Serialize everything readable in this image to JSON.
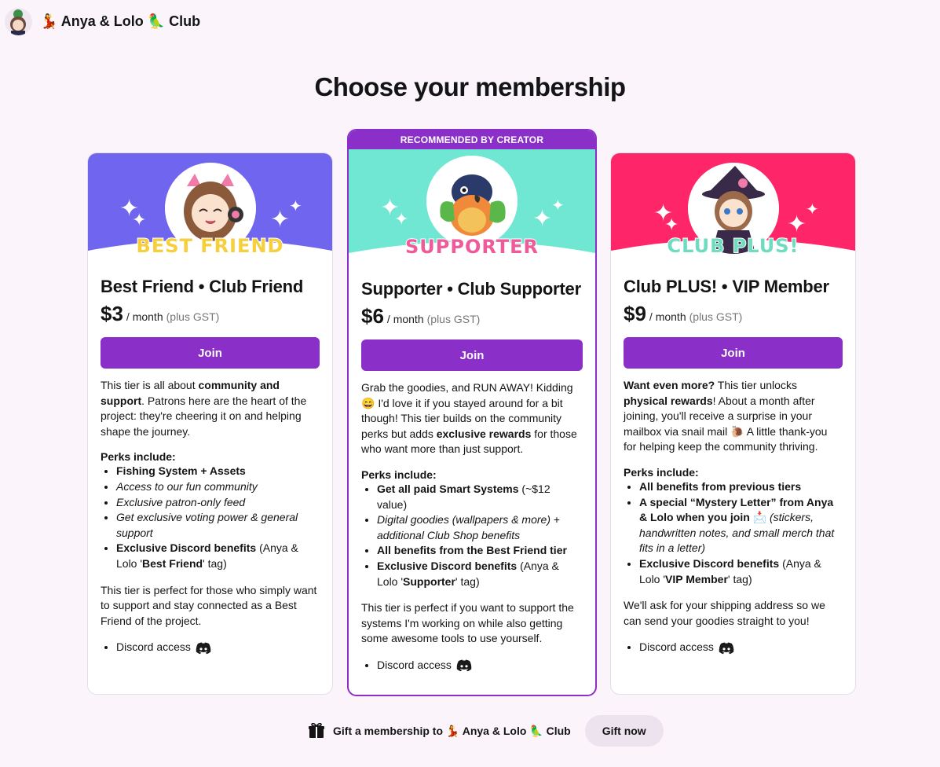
{
  "header": {
    "club_name": "💃 Anya & Lolo 🦜 Club"
  },
  "page_title": "Choose your membership",
  "recommended_label": "RECOMMENDED BY CREATOR",
  "tiers": [
    {
      "badge": "BEST FRIEND",
      "title": "Best Friend • Club Friend",
      "price": "$3",
      "period": "/ month",
      "tax": "(plus GST)",
      "join": "Join",
      "header_color": "#7065ee",
      "desc": [
        {
          "t": "This tier is all about "
        },
        {
          "t": "community and support",
          "b": true
        },
        {
          "t": ". Patrons here are the heart of the project: they're cheering it on and helping shape the journey."
        }
      ],
      "perks_heading": "Perks include:",
      "perks": [
        [
          {
            "t": "Fishing System + Assets",
            "b": true
          }
        ],
        [
          {
            "t": "Access to our fun community",
            "i": true
          }
        ],
        [
          {
            "t": "Exclusive patron-only feed",
            "i": true
          }
        ],
        [
          {
            "t": "Get exclusive voting power & general support",
            "i": true
          }
        ],
        [
          {
            "t": "Exclusive Discord benefits",
            "b": true
          },
          {
            "t": " (Anya & Lolo '"
          },
          {
            "t": "Best Friend",
            "b": true
          },
          {
            "t": "' tag)"
          }
        ]
      ],
      "closing": "This tier is perfect for those who simply want to support and stay connected as a Best Friend of the project.",
      "discord": "Discord access"
    },
    {
      "badge": "SUPPORTER",
      "title": "Supporter • Club Supporter",
      "price": "$6",
      "period": "/ month",
      "tax": "(plus GST)",
      "join": "Join",
      "header_color": "#6fe7d3",
      "desc": [
        {
          "t": "Grab the goodies, and RUN AWAY! Kidding 😄 I'd love it if you stayed around for a bit though! This tier builds on the community perks but adds "
        },
        {
          "t": "exclusive rewards",
          "b": true
        },
        {
          "t": " for those who want more than just support."
        }
      ],
      "perks_heading": "Perks include:",
      "perks": [
        [
          {
            "t": "Get all paid Smart Systems",
            "b": true
          },
          {
            "t": " (~$12 value)"
          }
        ],
        [
          {
            "t": "Digital goodies (wallpapers & more)",
            "i": true
          },
          {
            "t": " + "
          },
          {
            "t": "additional Club Shop benefits",
            "i": true
          }
        ],
        [
          {
            "t": "All benefits from the Best Friend tier",
            "b": true
          }
        ],
        [
          {
            "t": "Exclusive Discord benefits",
            "b": true
          },
          {
            "t": " (Anya & Lolo '"
          },
          {
            "t": "Supporter",
            "b": true
          },
          {
            "t": "' tag)"
          }
        ]
      ],
      "closing": "This tier is perfect if you want to support the systems I'm working on while also getting some awesome tools to use yourself.",
      "discord": "Discord access"
    },
    {
      "badge": "CLUB PLUS!",
      "title": "Club PLUS! • VIP Member",
      "price": "$9",
      "period": "/ month",
      "tax": "(plus GST)",
      "join": "Join",
      "header_color": "#fe2669",
      "desc": [
        {
          "t": "Want even more?",
          "b": true
        },
        {
          "t": " This tier unlocks "
        },
        {
          "t": "physical rewards",
          "b": true
        },
        {
          "t": "! About a month after joining, you'll receive a surprise in your mailbox via snail mail 🐌 A little thank-you for helping keep the community thriving."
        }
      ],
      "perks_heading": "Perks include:",
      "perks": [
        [
          {
            "t": "All benefits from previous tiers",
            "b": true
          }
        ],
        [
          {
            "t": "A special “Mystery Letter” from Anya & Lolo when you join",
            "b": true
          },
          {
            "t": " 📩 "
          },
          {
            "t": "(stickers, handwritten notes, and small merch that fits in a letter)",
            "i": true
          }
        ],
        [
          {
            "t": "Exclusive Discord benefits",
            "b": true
          },
          {
            "t": " (Anya & Lolo '"
          },
          {
            "t": "VIP Member",
            "b": true
          },
          {
            "t": "' tag)"
          }
        ]
      ],
      "closing": "We'll ask for your shipping address so we can send your goodies straight to you!",
      "discord": "Discord access"
    }
  ],
  "gift": {
    "text": "Gift a membership to 💃 Anya & Lolo 🦜 Club",
    "button": "Gift now"
  }
}
